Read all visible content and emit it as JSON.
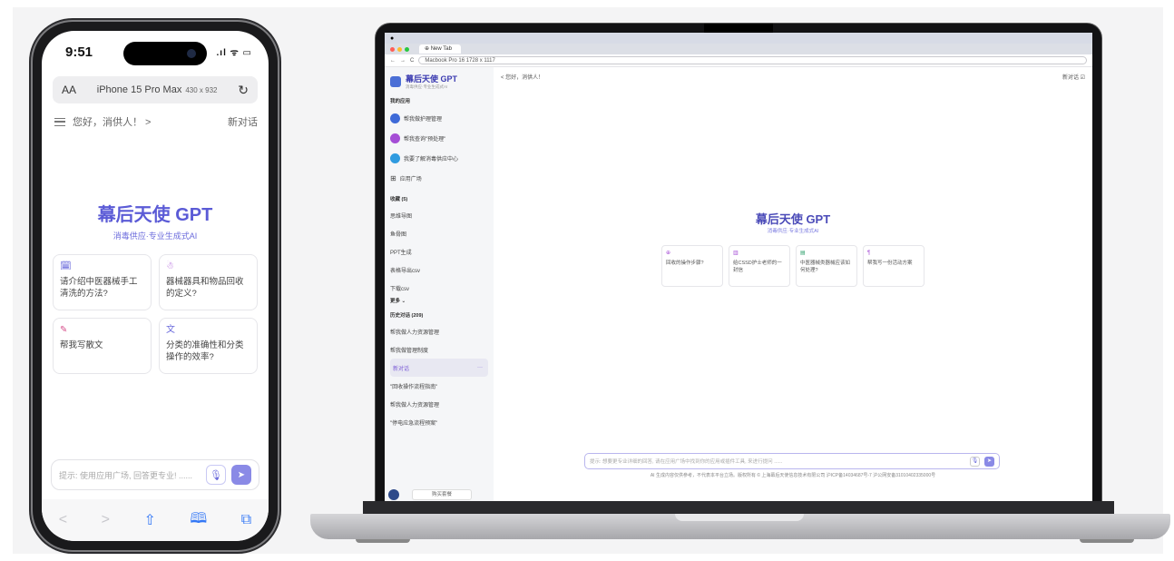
{
  "phone": {
    "status": {
      "time": "9:51",
      "icons": ".ıl ᯤ ▭"
    },
    "browser": {
      "aa": "AA",
      "device": "iPhone 15 Pro Max",
      "size": "430 x 932",
      "reload": "↻"
    },
    "top": {
      "greeting": "您好，消供人！ >",
      "new_chat": "新对话"
    },
    "title": "幕后天使 GPT",
    "subtitle": "消毒供应·专业生成式AI",
    "cards": [
      {
        "icon": "🗓",
        "text": "请介绍中医器械手工清洗的方法?"
      },
      {
        "icon": "☃",
        "text": "器械器具和物品回收的定义?"
      },
      {
        "icon": "✎",
        "text": "帮我写散文"
      },
      {
        "icon": "文",
        "text": "分类的准确性和分类操作的效率?"
      }
    ],
    "input": {
      "placeholder": "提示: 使用应用广场, 回答更专业! ......",
      "mic": "🎙",
      "send": "➤"
    },
    "nav": [
      "<",
      ">",
      "⇧",
      "🕮",
      "⧉"
    ]
  },
  "laptop": {
    "menubar": " ",
    "tab": {
      "label": "⊕ New Tab"
    },
    "address": {
      "back": "←",
      "forward": "→",
      "reload": "C",
      "url": "Macbook Pro 16  1728 x 1117"
    },
    "sidebar": {
      "logo_title": "幕后天使 GPT",
      "logo_sub": "消毒供应·专业生成式AI",
      "my_apps": "我的应用",
      "apps": [
        {
          "label": "帮我做护理管理",
          "color": "#3e6ad8"
        },
        {
          "label": "帮我查询\"预处理\"",
          "color": "#a54ed6"
        },
        {
          "label": "我要了解消毒供应中心",
          "color": "#2f9be0"
        },
        {
          "label": "应用广场",
          "color": "#ffffff"
        }
      ],
      "fav_header": "收藏 (5)",
      "favs": [
        "思维导图",
        "鱼骨图",
        "PPT生成",
        "表格导出csv",
        "下载csv"
      ],
      "more": "更多 ⌄",
      "history_header": "历史对话 (209)",
      "history": [
        "帮我做人力资源管理",
        "帮我做管理制度",
        "新对话",
        "\"回收操作流程指南\"",
        "帮我做人力资源管理",
        "\"停电应急流程预案\""
      ],
      "active_dots": "···",
      "buy": "购买套餐"
    },
    "main": {
      "greeting": "< 您好，消供人！",
      "new_chat": "新对话 ☑",
      "title": "幕后天使 GPT",
      "subtitle": "消毒供应·专业生成式AI",
      "cards": [
        {
          "icon": "⊕",
          "text": "回收的操作步骤?"
        },
        {
          "icon": "▥",
          "text": "给CSSD护士老师的一封信"
        },
        {
          "icon": "▤",
          "text": "中医器械类器械应该如何处理?"
        },
        {
          "icon": "¶",
          "text": "帮我写一份活动方案"
        }
      ],
      "input": {
        "placeholder": "提示: 想要更专业详细的回答, 请在应用广场中找到你的应用或插件工具, 来进行提问 ......",
        "mic": "🎙",
        "send": "➤"
      },
      "footer": "AI 生成内容仅供参考，不代表本平台立场。版权所有 © 上海幕后天使信息技术有限公司 沪ICP备14034687号-7 沪公网安备31010402335000号"
    }
  }
}
